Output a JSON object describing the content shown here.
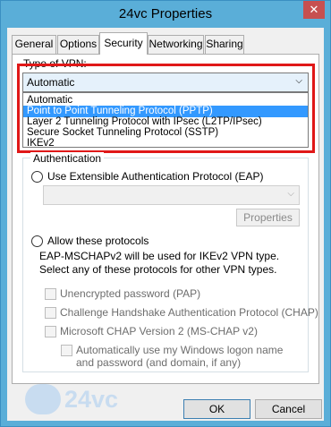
{
  "window": {
    "title": "24vc Properties",
    "close_symbol": "✕"
  },
  "tabs": [
    {
      "label": "General"
    },
    {
      "label": "Options"
    },
    {
      "label": "Security"
    },
    {
      "label": "Networking"
    },
    {
      "label": "Sharing"
    }
  ],
  "vpn": {
    "label": "Type of VPN:",
    "selected": "Automatic",
    "options": [
      "Automatic",
      "Point to Point Tunneling Protocol (PPTP)",
      "Layer 2 Tunneling Protocol with IPsec (L2TP/IPsec)",
      "Secure Socket Tunneling Protocol (SSTP)",
      "IKEv2"
    ],
    "highlighted_option": "Point to Point Tunneling Protocol (PPTP)"
  },
  "auth": {
    "legend": "Authentication",
    "eap_label": "Use Extensible Authentication Protocol (EAP)",
    "properties_button": "Properties",
    "allow_label": "Allow these protocols",
    "note": "EAP-MSCHAPv2 will be used for IKEv2 VPN type. Select any of these protocols for other VPN types.",
    "protocols": [
      "Unencrypted password (PAP)",
      "Challenge Handshake Authentication Protocol (CHAP)",
      "Microsoft CHAP Version 2 (MS-CHAP v2)"
    ],
    "auto_logon": "Automatically use my Windows logon name and password (and domain, if any)"
  },
  "buttons": {
    "ok": "OK",
    "cancel": "Cancel"
  },
  "watermark": {
    "text": "24vc"
  },
  "colors": {
    "titlebar": "#5aaed8",
    "highlight_border": "#e01818",
    "selected_item": "#3399ff"
  }
}
